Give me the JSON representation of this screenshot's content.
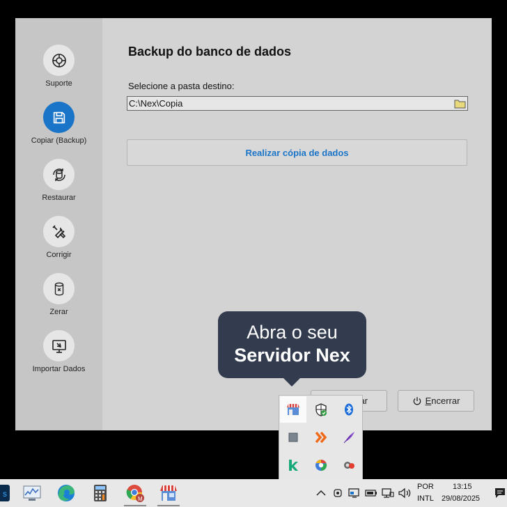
{
  "sidebar": {
    "items": [
      {
        "label": "Suporte",
        "icon": "lifebuoy-icon"
      },
      {
        "label": "Copiar (Backup)",
        "icon": "save-icon",
        "active": true
      },
      {
        "label": "Restaurar",
        "icon": "restore-database-icon"
      },
      {
        "label": "Corrigir",
        "icon": "tools-icon"
      },
      {
        "label": "Zerar",
        "icon": "clear-database-icon"
      },
      {
        "label": "Importar Dados",
        "icon": "import-icon"
      }
    ]
  },
  "main": {
    "title": "Backup do banco de dados",
    "destination_label": "Selecione a pasta destino:",
    "destination_path": "C:\\Nex\\Copia",
    "copy_button": "Realizar cópia de dados"
  },
  "footer": {
    "hidden_button_partial": "ar",
    "exit_button_mnemonic": "E",
    "exit_button_rest": "ncerrar"
  },
  "tooltip": {
    "line1": "Abra o seu",
    "line2": "Servidor Nex"
  },
  "tray_popup": {
    "icons": [
      "nex-server-store-icon",
      "security-shield-icon",
      "bluetooth-icon",
      "gray-square-icon",
      "orange-chevrons-icon",
      "purple-feather-icon",
      "green-k-icon",
      "browser-icon",
      "reddot-app-icon"
    ]
  },
  "taskbar": {
    "apps": [
      "ps-app-icon",
      "performance-monitor-icon",
      "edge-icon",
      "calculator-icon",
      "chrome-icon",
      "store-icon"
    ],
    "language_line1": "POR",
    "language_line2": "INTL",
    "time": "13:15",
    "date": "29/08/2025"
  },
  "colors": {
    "accent": "#1a74c7",
    "tooltip_bg": "#333c4e",
    "sidebar_bg": "#c6c6c6",
    "content_bg": "#d3d3d3"
  }
}
